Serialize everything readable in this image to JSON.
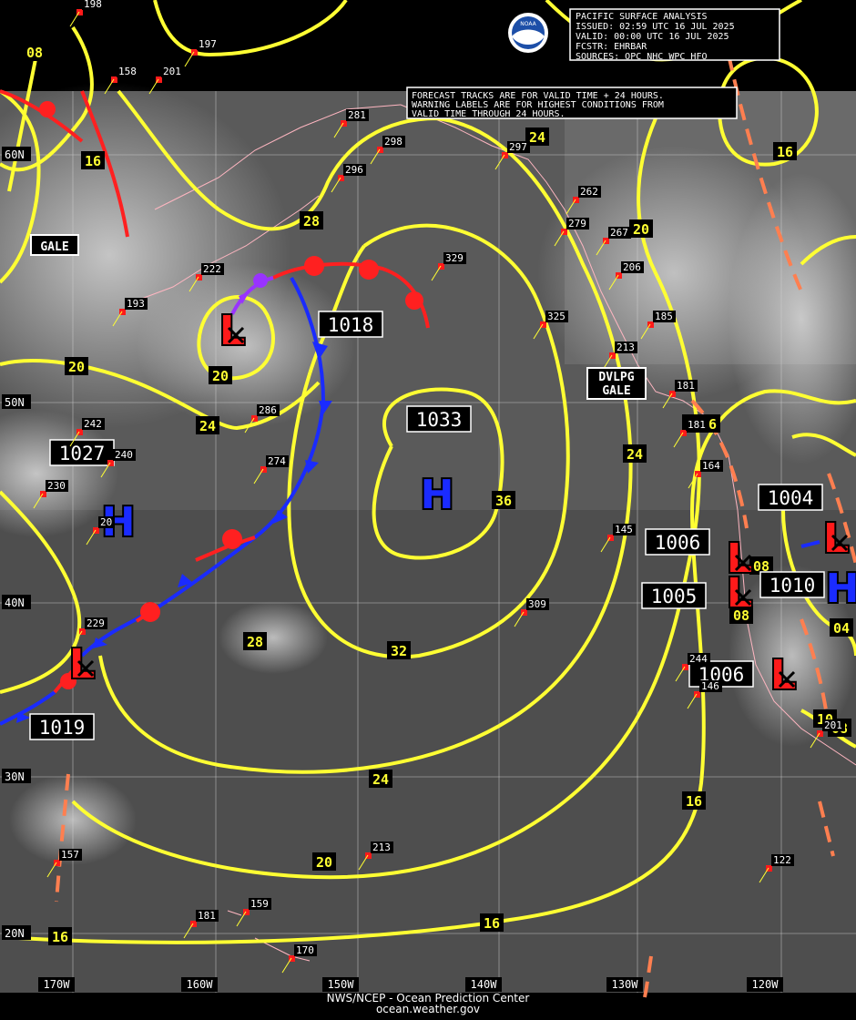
{
  "header": {
    "line1": "PACIFIC SURFACE ANALYSIS",
    "line2": "ISSUED: 02:59 UTC 16 JUL 2025",
    "line3": "VALID:  00:00 UTC 16 JUL 2025",
    "line4": "FCSTR:  EHRBAR",
    "line5": "SOURCES: OPC NHC WPC HFO",
    "logo": "noaa-logo",
    "logo_text": "NOAA"
  },
  "notice": {
    "line1": "FORECAST TRACKS ARE FOR VALID TIME + 24 HOURS.",
    "line2": "WARNING LABELS ARE FOR HIGHEST CONDITIONS FROM",
    "line3": "VALID TIME THROUGH 24 HOURS."
  },
  "latitudes": [
    "60N",
    "50N",
    "40N",
    "30N",
    "20N"
  ],
  "longitudes": [
    "170W",
    "160W",
    "150W",
    "140W",
    "130W",
    "120W"
  ],
  "pressure_centers": [
    {
      "type": "L",
      "value": "1018"
    },
    {
      "type": "H",
      "value": "1033"
    },
    {
      "type": "H",
      "value": "1027"
    },
    {
      "type": "L",
      "value": "1019"
    },
    {
      "type": "L",
      "value": "1004"
    },
    {
      "type": "L",
      "value": "1006"
    },
    {
      "type": "L",
      "value": "1005"
    },
    {
      "type": "H",
      "value": "1010"
    },
    {
      "type": "L",
      "value": "1006"
    }
  ],
  "isobar_labels": [
    "08",
    "16",
    "16",
    "20",
    "20",
    "24",
    "28",
    "24",
    "20",
    "16",
    "36",
    "24",
    "28",
    "32",
    "24",
    "20",
    "16",
    "16",
    "08",
    "04",
    "16",
    "08",
    "16",
    "10",
    "08"
  ],
  "warnings": {
    "gale": "GALE",
    "dvlpg_line1": "DVLPG",
    "dvlpg_line2": "GALE"
  },
  "ship_obs": [
    "198",
    "197",
    "158",
    "201",
    "281",
    "298",
    "296",
    "297",
    "222",
    "193",
    "329",
    "279",
    "262",
    "267",
    "206",
    "325",
    "185",
    "213",
    "181",
    "181",
    "164",
    "242",
    "240",
    "230",
    "286",
    "274",
    "145",
    "309",
    "229",
    "244",
    "146",
    "157",
    "213",
    "122",
    "181",
    "159",
    "170",
    "201",
    "20"
  ],
  "footer": {
    "line1": "NWS/NCEP - Ocean Prediction Center",
    "line2": "ocean.weather.gov"
  },
  "colors": {
    "isobar": "#ffff33",
    "cold_front": "#1a2bff",
    "warm_front": "#ff2020",
    "occluded_front": "#9933ff",
    "trough": "#ff7f50",
    "low": "#ff1a1a",
    "high": "#1a2bff"
  }
}
